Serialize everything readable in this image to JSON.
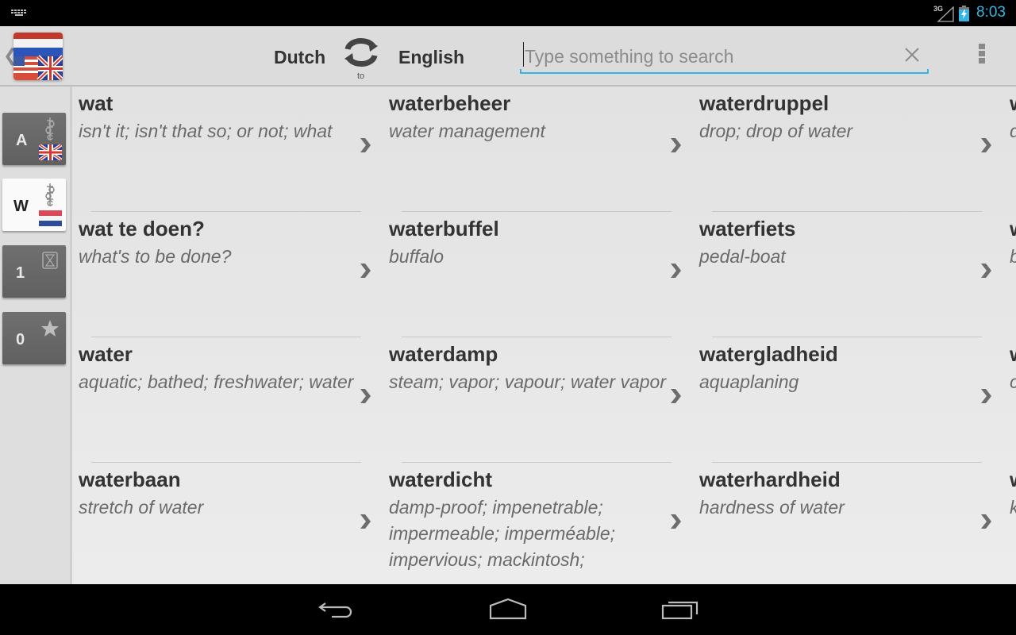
{
  "status_bar": {
    "keyboard_icon": "keyboard-icon",
    "network_label": "3G",
    "signal_icon": "signal-icon",
    "battery_icon": "battery-charging-icon",
    "time": "8:03",
    "accent_color": "#33b5e5"
  },
  "action_bar": {
    "up_icon": "chevron-left-icon",
    "logo": "flags-logo",
    "source_language": "Dutch",
    "swap_icon": "swap-languages-icon",
    "swap_caption": "to",
    "target_language": "English",
    "search": {
      "value": "",
      "placeholder": "Type something to search"
    },
    "clear_icon": "close-icon",
    "overflow_icon": "overflow-menu-icon"
  },
  "side_tabs": [
    {
      "label": "A",
      "glyph": "alphabet-icon",
      "flag": "uk-flag",
      "active": false
    },
    {
      "label": "W",
      "glyph": "alphabet-icon",
      "flag": "nl-flag",
      "active": true
    },
    {
      "label": "1",
      "glyph": "history-icon",
      "active": false
    },
    {
      "label": "0",
      "glyph": "star-icon",
      "active": false
    }
  ],
  "entries": [
    {
      "word": "wat",
      "translation": "isn't it; isn't that so; or not; what"
    },
    {
      "word": "waterbeheer",
      "translation": "water management"
    },
    {
      "word": "waterdruppel",
      "translation": "drop; drop of water"
    },
    {
      "word": "w",
      "translation": "d"
    },
    {
      "word": "wat te doen?",
      "translation": "what's to be done?"
    },
    {
      "word": "waterbuffel",
      "translation": "buffalo"
    },
    {
      "word": "waterfiets",
      "translation": "pedal-boat"
    },
    {
      "word": "w",
      "translation": "b l"
    },
    {
      "word": "water",
      "translation": "aquatic; bathed; freshwater; water"
    },
    {
      "word": "waterdamp",
      "translation": "steam; vapor; vapour; water vapor"
    },
    {
      "word": "watergladheid",
      "translation": "aquaplaning"
    },
    {
      "word": "w",
      "translation": "c"
    },
    {
      "word": "waterbaan",
      "translation": "stretch of water"
    },
    {
      "word": "waterdicht",
      "translation": "damp-proof; impenetrable; impermeable; imperméable; impervious; mackintosh;"
    },
    {
      "word": "waterhardheid",
      "translation": "hardness of water"
    },
    {
      "word": "w",
      "translation": "k"
    }
  ],
  "nav_bar": {
    "back_icon": "back-icon",
    "home_icon": "home-icon",
    "recents_icon": "recent-apps-icon"
  }
}
